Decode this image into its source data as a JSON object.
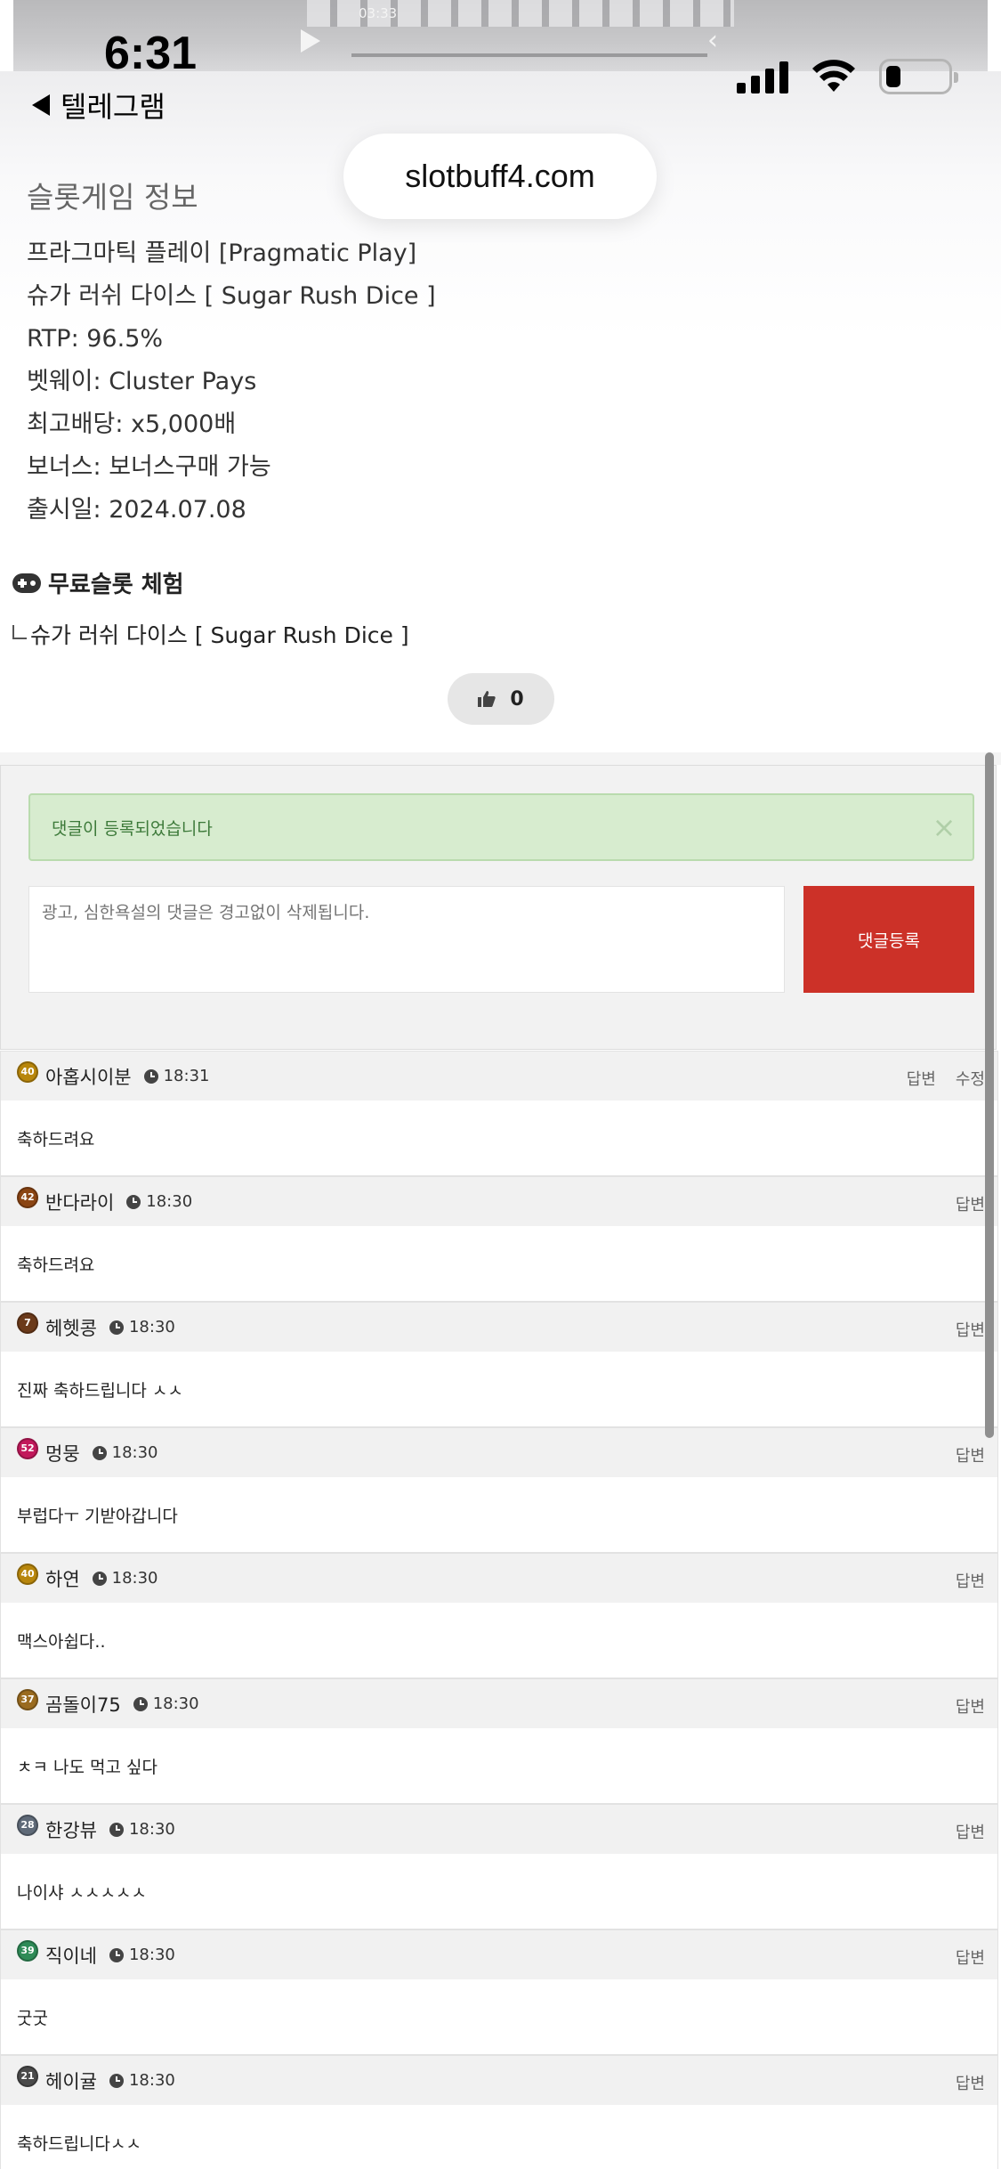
{
  "status_bar": {
    "time": "6:31"
  },
  "video_strip": {
    "time": "03:33"
  },
  "back_link": {
    "label": "텔레그램"
  },
  "url_bar": {
    "url": "slotbuff4.com"
  },
  "info": {
    "heading": "슬롯게임 정보",
    "lines": [
      "프라그마틱 플레이 [Pragmatic Play]",
      "슈가 러쉬 다이스 [ Sugar Rush Dice ]",
      "RTP: 96.5%",
      "벳웨이: Cluster Pays",
      "최고배당: x5,000배",
      "보너스: 보너스구매 가능",
      "출시일: 2024.07.08"
    ]
  },
  "free_trial": {
    "label": "무료슬롯 체험",
    "link": "슈가 러쉬 다이스 [ Sugar Rush Dice ]"
  },
  "like": {
    "count": "0"
  },
  "comment_form": {
    "alert": "댓글이 등록되었습니다",
    "placeholder": "광고, 심한욕설의 댓글은 경고없이 삭제됩니다.",
    "submit": "댓글등록"
  },
  "comments": [
    {
      "level": "40",
      "badge_color": "#b8860b",
      "user": "아홉시이분",
      "time": "18:31",
      "reply": "답변",
      "edit": "수정",
      "text": "축하드려요"
    },
    {
      "level": "42",
      "badge_color": "#8b4513",
      "user": "반다라이",
      "time": "18:30",
      "reply": "답변",
      "edit": "",
      "text": "축하드려요"
    },
    {
      "level": "7",
      "badge_color": "#6b3a1a",
      "user": "헤헷콩",
      "time": "18:30",
      "reply": "답변",
      "edit": "",
      "text": "진짜 축하드립니다 ㅅㅅ"
    },
    {
      "level": "52",
      "badge_color": "#c2185b",
      "user": "멍뭉",
      "time": "18:30",
      "reply": "답변",
      "edit": "",
      "text": "부럽다ㅜ 기받아갑니다"
    },
    {
      "level": "40",
      "badge_color": "#b8860b",
      "user": "하연",
      "time": "18:30",
      "reply": "답변",
      "edit": "",
      "text": "맥스아쉽다.."
    },
    {
      "level": "37",
      "badge_color": "#9a6b1f",
      "user": "곰돌이75",
      "time": "18:30",
      "reply": "답변",
      "edit": "",
      "text": "ㅊㅋ 나도 먹고 싶다"
    },
    {
      "level": "28",
      "badge_color": "#5f6a78",
      "user": "한강뷰",
      "time": "18:30",
      "reply": "답변",
      "edit": "",
      "text": "나이샤 ㅅㅅㅅㅅㅅ"
    },
    {
      "level": "39",
      "badge_color": "#2e8b57",
      "user": "직이네",
      "time": "18:30",
      "reply": "답변",
      "edit": "",
      "text": "굿굿"
    },
    {
      "level": "21",
      "badge_color": "#4a4a4a",
      "user": "헤이귤",
      "time": "18:30",
      "reply": "답변",
      "edit": "",
      "text": "축하드립니다ㅅㅅ"
    }
  ]
}
